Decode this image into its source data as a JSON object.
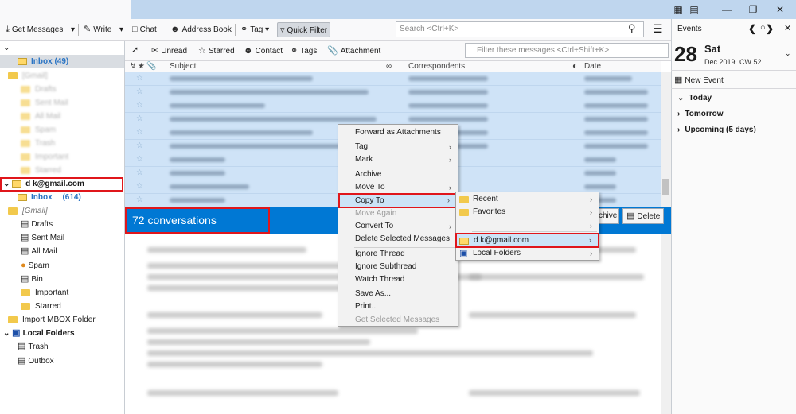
{
  "toolbar": {
    "get_messages": "Get Messages",
    "write": "Write",
    "chat": "Chat",
    "address_book": "Address Book",
    "tag": "Tag",
    "quick_filter": "Quick Filter",
    "search_placeholder": "Search <Ctrl+K>"
  },
  "filterbar": {
    "unread": "Unread",
    "starred": "Starred",
    "contact": "Contact",
    "tags": "Tags",
    "attachment": "Attachment",
    "filter_placeholder": "Filter these messages <Ctrl+Shift+K>"
  },
  "columns": {
    "subject": "Subject",
    "correspondents": "Correspondents",
    "date": "Date"
  },
  "folders": {
    "account1_inbox": "Inbox (49)",
    "account2_name": "d                k@gmail.com",
    "account2_inbox": "Inbox",
    "account2_inbox_count": "(614)",
    "gmail": "[Gmail]",
    "items": [
      "Drafts",
      "Sent Mail",
      "All Mail",
      "Spam",
      "Bin",
      "Important",
      "Starred"
    ],
    "import_mbox": "Import MBOX Folder",
    "local_folders": "Local Folders",
    "trash": "Trash",
    "outbox": "Outbox"
  },
  "selection": {
    "count": "72 conversations",
    "archive": "Archive",
    "delete": "Delete"
  },
  "events": {
    "title": "Events",
    "day": "28",
    "weekday": "Sat",
    "month_year": "Dec 2019",
    "week": "CW 52",
    "new_event": "New Event",
    "today": "Today",
    "tomorrow": "Tomorrow",
    "upcoming": "Upcoming (5 days)"
  },
  "context_menu": {
    "forward_as_attachments": "Forward as Attachments",
    "tag": "Tag",
    "mark": "Mark",
    "archive": "Archive",
    "move_to": "Move To",
    "copy_to": "Copy To",
    "move_again": "Move Again",
    "convert_to": "Convert To",
    "delete_selected": "Delete Selected Messages",
    "ignore_thread": "Ignore Thread",
    "ignore_subthread": "Ignore Subthread",
    "watch_thread": "Watch Thread",
    "save_as": "Save As...",
    "print": "Print...",
    "get_selected": "Get Selected Messages"
  },
  "copy_submenu": {
    "recent": "Recent",
    "favorites": "Favorites",
    "account": "d                k@gmail.com",
    "local_folders": "Local Folders"
  },
  "colors": {
    "selection_blue": "#0078d4",
    "list_selected": "#cfe3f7",
    "highlight_red": "#e0161b",
    "folder_yellow": "#f2c94c"
  }
}
